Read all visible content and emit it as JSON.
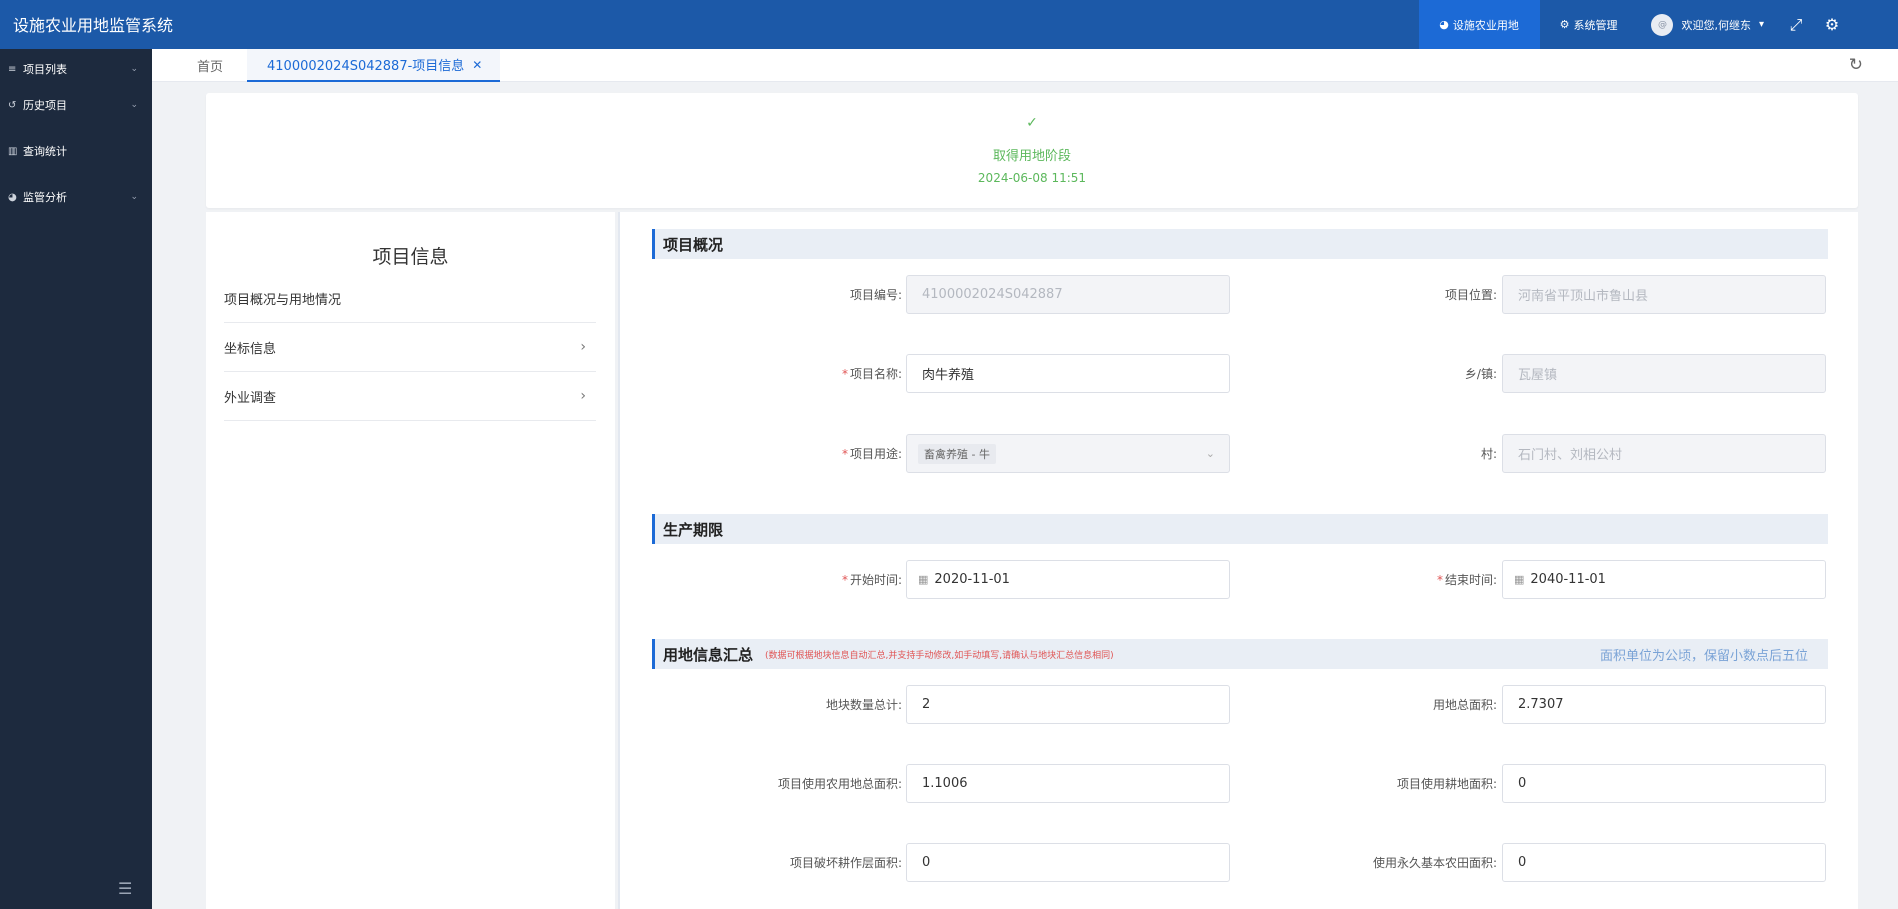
{
  "app": {
    "title": "设施农业用地监管系统"
  },
  "header": {
    "nav": [
      {
        "label": "设施农业用地",
        "icon": "pie-chart-icon",
        "active": true
      },
      {
        "label": "系统管理",
        "icon": "gears-icon",
        "active": false
      }
    ],
    "user": {
      "greeting": "欢迎您,何继东",
      "avatar_text": "@"
    }
  },
  "sidebar": {
    "items": [
      {
        "label": "项目列表",
        "icon": "list-icon",
        "has_children": true
      },
      {
        "label": "历史项目",
        "icon": "history-icon",
        "has_children": true
      },
      {
        "label": "查询统计",
        "icon": "bar-chart-icon",
        "has_children": false
      },
      {
        "label": "监管分析",
        "icon": "pie-chart-icon",
        "has_children": true
      }
    ]
  },
  "tabs": {
    "home": "首页",
    "current": "4100002024S042887-项目信息"
  },
  "status": {
    "stage": "取得用地阶段",
    "time": "2024-06-08 11:51"
  },
  "left_panel": {
    "title": "项目信息",
    "items": [
      {
        "label": "项目概况与用地情况"
      },
      {
        "label": "坐标信息"
      },
      {
        "label": "外业调查"
      }
    ]
  },
  "overview": {
    "title": "项目概况",
    "fields": {
      "project_no": {
        "label": "项目编号:",
        "value": "4100002024S042887"
      },
      "location": {
        "label": "项目位置:",
        "value": "河南省平顶山市鲁山县"
      },
      "name": {
        "label": "项目名称:",
        "value": "肉牛养殖"
      },
      "town": {
        "label": "乡/镇:",
        "value": "瓦屋镇"
      },
      "usage": {
        "label": "项目用途:",
        "value": "畜禽养殖 - 牛"
      },
      "village": {
        "label": "村:",
        "value": "石门村、刘相公村"
      }
    }
  },
  "period": {
    "title": "生产期限",
    "start": {
      "label": "开始时间:",
      "value": "2020-11-01"
    },
    "end": {
      "label": "结束时间:",
      "value": "2040-11-01"
    }
  },
  "land_summary": {
    "title": "用地信息汇总",
    "note": "(数据可根据地块信息自动汇总,并支持手动修改,如手动填写,请确认与地块汇总信息相同)",
    "unit_note": "面积单位为公顷，保留小数点后五位",
    "fields": {
      "plot_count": {
        "label": "地块数量总计:",
        "value": "2"
      },
      "total_area": {
        "label": "用地总面积:",
        "value": "2.7307"
      },
      "farmland_area": {
        "label": "项目使用农用地总面积:",
        "value": "1.1006"
      },
      "cultivated_area": {
        "label": "项目使用耕地面积:",
        "value": "0"
      },
      "damaged_area": {
        "label": "项目破坏耕作层面积:",
        "value": "0"
      },
      "basic_farmland_area": {
        "label": "使用永久基本农田面积:",
        "value": "0"
      }
    }
  }
}
